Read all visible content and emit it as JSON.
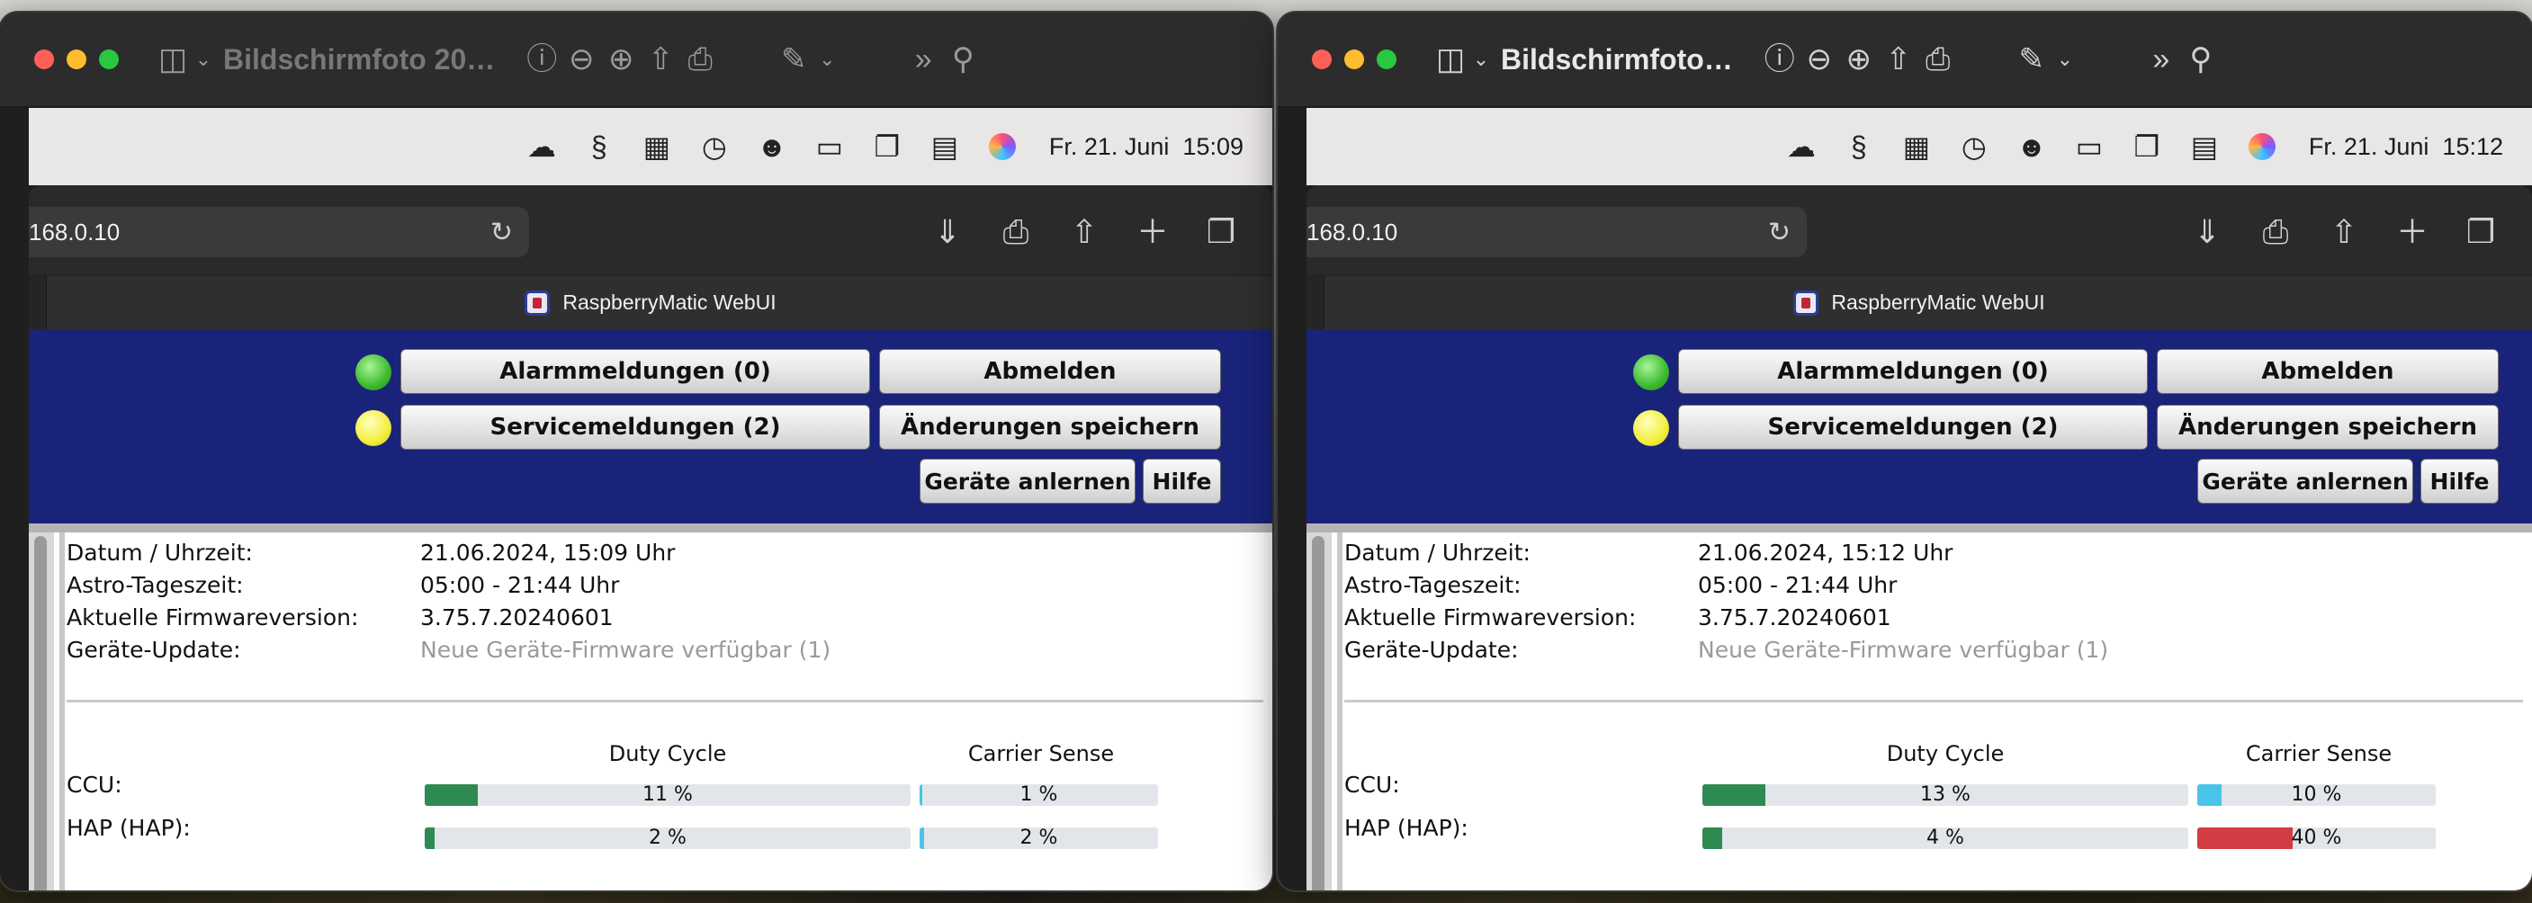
{
  "windows": [
    {
      "id": "left",
      "active": false,
      "title": "Bildschirmfoto 20…",
      "menubar": {
        "date": "Fr. 21. Juni",
        "time": "15:09"
      },
      "url": "168.0.10",
      "tab_title": "RaspberryMatic WebUI",
      "buttons": {
        "alarm": "Alarmmeldungen (0)",
        "logout": "Abmelden",
        "service": "Servicemeldungen (2)",
        "save": "Änderungen speichern",
        "learn": "Geräte anlernen",
        "help": "Hilfe"
      },
      "info": {
        "datetime_label": "Datum / Uhrzeit:",
        "datetime_value": "21.06.2024, 15:09 Uhr",
        "astro_label": "Astro-Tageszeit:",
        "astro_value": "05:00 - 21:44 Uhr",
        "firmware_label": "Aktuelle Firmwareversion:",
        "firmware_value": "3.75.7.20240601",
        "update_label": "Geräte-Update:",
        "update_value": "Neue Geräte-Firmware verfügbar (1)"
      },
      "radio": {
        "duty_header": "Duty Cycle",
        "carrier_header": "Carrier Sense",
        "rows": [
          {
            "label": "CCU:",
            "duty_text": "11 %",
            "duty": 11,
            "carrier_text": "1 %",
            "carrier": 1,
            "carrier_color": "blue"
          },
          {
            "label": "HAP (HAP):",
            "duty_text": "2 %",
            "duty": 2,
            "carrier_text": "2 %",
            "carrier": 2,
            "carrier_color": "blue"
          }
        ]
      }
    },
    {
      "id": "right",
      "active": true,
      "title": "Bildschirmfoto…",
      "menubar": {
        "date": "Fr. 21. Juni",
        "time": "15:12"
      },
      "url": "168.0.10",
      "tab_title": "RaspberryMatic WebUI",
      "buttons": {
        "alarm": "Alarmmeldungen (0)",
        "logout": "Abmelden",
        "service": "Servicemeldungen (2)",
        "save": "Änderungen speichern",
        "learn": "Geräte anlernen",
        "help": "Hilfe"
      },
      "info": {
        "datetime_label": "Datum / Uhrzeit:",
        "datetime_value": "21.06.2024, 15:12 Uhr",
        "astro_label": "Astro-Tageszeit:",
        "astro_value": "05:00 - 21:44 Uhr",
        "firmware_label": "Aktuelle Firmwareversion:",
        "firmware_value": "3.75.7.20240601",
        "update_label": "Geräte-Update:",
        "update_value": "Neue Geräte-Firmware verfügbar (1)"
      },
      "radio": {
        "duty_header": "Duty Cycle",
        "carrier_header": "Carrier Sense",
        "rows": [
          {
            "label": "CCU:",
            "duty_text": "13 %",
            "duty": 13,
            "carrier_text": "10 %",
            "carrier": 10,
            "carrier_color": "blue"
          },
          {
            "label": "HAP (HAP):",
            "duty_text": "4 %",
            "duty": 4,
            "carrier_text": "40 %",
            "carrier": 40,
            "carrier_color": "red"
          }
        ]
      }
    }
  ],
  "colors": {
    "header_bg": "#19237a",
    "duty_fill": "#2f8a52",
    "carrier_blue": "#49c4e8",
    "carrier_red": "#d23c43"
  },
  "icons": {
    "titlebar": [
      "sidebar-icon",
      "chevron-down-icon",
      "info-icon",
      "zoom-out-icon",
      "zoom-in-icon",
      "share-icon",
      "print-icon",
      "markup-icon",
      "chevron-down-icon",
      "more-icon",
      "search-icon"
    ],
    "menubar": [
      "cloud-icon",
      "snake-icon",
      "layout-icon",
      "time-machine-icon",
      "user-icon",
      "battery-icon",
      "screens-icon",
      "control-center-icon",
      "siri-icon"
    ],
    "safari": [
      "reload-icon",
      "download-icon",
      "print-icon",
      "share-icon",
      "new-tab-icon",
      "tabs-icon"
    ]
  }
}
